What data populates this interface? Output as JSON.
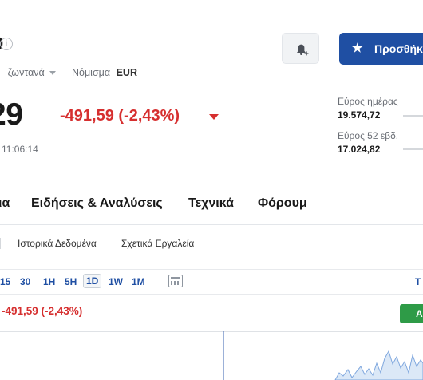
{
  "header": {
    "ticker_edge": "0",
    "info_icon": "i",
    "live_label": "- ζωντανά",
    "currency_label": "Νόμισμα",
    "currency_value": "EUR",
    "price": "29",
    "change": "-491,59 (-2,43%)",
    "time": "11:06:14"
  },
  "actions": {
    "alert_icon": "bell-plus-icon",
    "add_label": "Προσθήκη",
    "add_icon": "star-icon"
  },
  "ranges": {
    "day_label": "Εύρος ημέρας",
    "day_value": "19.574,72",
    "week52_label": "Εύρος 52 εβδ.",
    "week52_value": "17.024,82"
  },
  "tabs": [
    {
      "label": "ια"
    },
    {
      "label": "Ειδήσεις & Αναλύσεις"
    },
    {
      "label": "Τεχνικά"
    },
    {
      "label": "Φόρουμ"
    }
  ],
  "subtabs": [
    {
      "label": "Ιστορικά Δεδομένα"
    },
    {
      "label": "Σχετικά Εργαλεία"
    }
  ],
  "timeframes": [
    "15",
    "30",
    "1H",
    "5H",
    "1D",
    "1W",
    "1M"
  ],
  "active_timeframe": "1D",
  "timeframe_right": "T",
  "chart": {
    "change": "491,59 (-2,43%)",
    "button_label": "A"
  },
  "colors": {
    "accent": "#1f4fa3",
    "negative": "#d62f2f",
    "positive": "#2e9b47"
  }
}
